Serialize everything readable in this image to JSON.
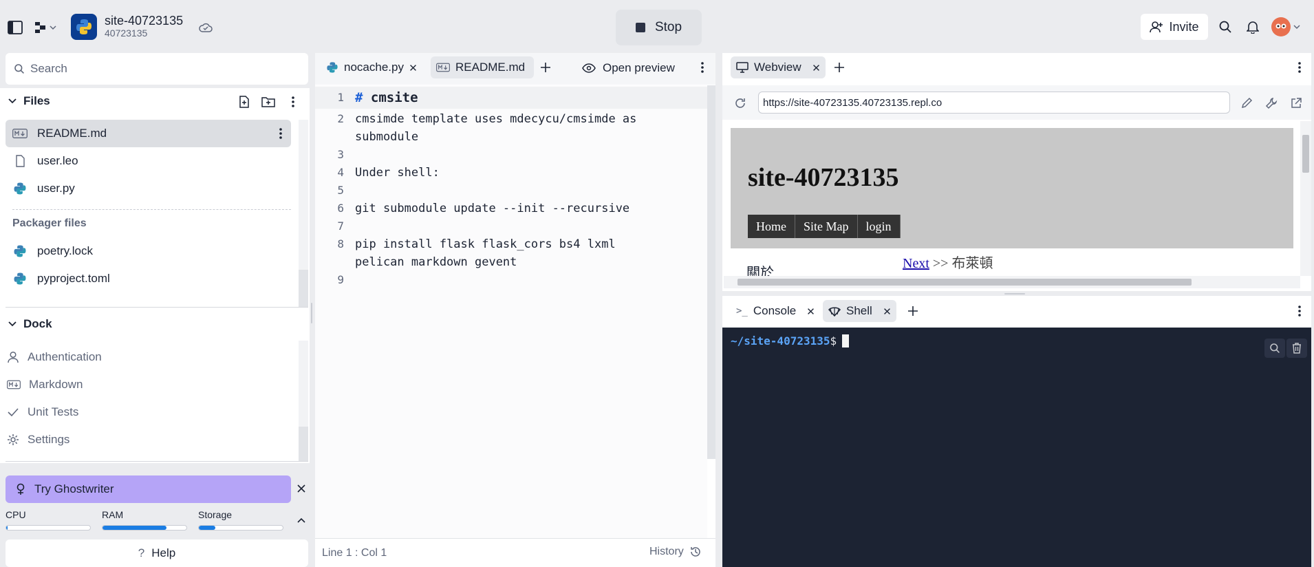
{
  "topbar": {
    "repl_name": "site-40723135",
    "repl_id": "40723135",
    "stop_label": "Stop",
    "invite_label": "Invite"
  },
  "sidebar": {
    "search_placeholder": "Search",
    "files_title": "Files",
    "files": [
      {
        "name": "README.md",
        "icon": "markdown-icon"
      },
      {
        "name": "user.leo",
        "icon": "file-icon"
      },
      {
        "name": "user.py",
        "icon": "python-icon"
      }
    ],
    "packager_title": "Packager files",
    "packager_files": [
      {
        "name": "poetry.lock",
        "icon": "python-icon"
      },
      {
        "name": "pyproject.toml",
        "icon": "python-icon"
      }
    ],
    "dock_title": "Dock",
    "dock_items": [
      {
        "label": "Authentication",
        "icon": "user-icon"
      },
      {
        "label": "Markdown",
        "icon": "markdown-icon"
      },
      {
        "label": "Unit Tests",
        "icon": "check-icon"
      },
      {
        "label": "Settings",
        "icon": "gear-icon"
      }
    ],
    "ghostwriter_label": "Try Ghostwriter",
    "resources": [
      {
        "label": "CPU",
        "fraction": 0.02
      },
      {
        "label": "RAM",
        "fraction": 0.76
      },
      {
        "label": "Storage",
        "fraction": 0.2
      }
    ],
    "help_label": "Help"
  },
  "editor": {
    "tabs": [
      {
        "label": "nocache.py",
        "icon": "python-icon",
        "active": false
      },
      {
        "label": "README.md",
        "icon": "markdown-icon",
        "active": true
      }
    ],
    "open_preview_label": "Open preview",
    "lines": [
      {
        "n": "1",
        "text": "# cmsite"
      },
      {
        "n": "2",
        "text": "cmsimde template uses mdecycu/cmsimde as submodule"
      },
      {
        "n": "3",
        "text": ""
      },
      {
        "n": "4",
        "text": "Under shell:"
      },
      {
        "n": "5",
        "text": ""
      },
      {
        "n": "6",
        "text": "git submodule update --init --recursive"
      },
      {
        "n": "7",
        "text": ""
      },
      {
        "n": "8",
        "text": "pip install flask flask_cors bs4 lxml pelican markdown gevent"
      },
      {
        "n": "9",
        "text": ""
      }
    ],
    "status_position": "Line 1 : Col 1",
    "history_label": "History"
  },
  "webview": {
    "tab_label": "Webview",
    "url": "https://site-40723135.40723135.repl.co",
    "site_title": "site-40723135",
    "nav": [
      "Home",
      "Site Map",
      "login"
    ],
    "next_link": "Next",
    "next_suffix": ">> 布萊頓",
    "body_text": "關於"
  },
  "console": {
    "tabs": [
      {
        "label": "Console",
        "icon": "console-icon",
        "active": false
      },
      {
        "label": "Shell",
        "icon": "shell-icon",
        "active": true
      }
    ],
    "prompt_path": "~/site-40723135",
    "prompt_symbol": "$"
  },
  "colors": {
    "accent": "#1b7de3",
    "ghostwriter": "#b5a4f7",
    "terminal_bg": "#1c2333",
    "prompt": "#5ba4f7"
  }
}
